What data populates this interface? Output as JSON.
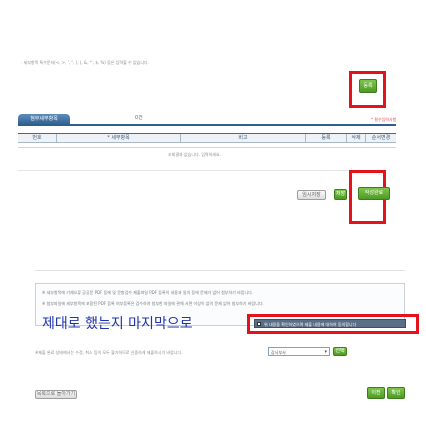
{
  "top_note": "· 세부항목 특수문자(<, >, ', \", (, ), &, ^, $, %) 등은 입력할 수 없습니다.",
  "save_button_label": "등록",
  "tab_label": "첨부세부항목",
  "count_label": "0건",
  "required_note": "* 필수입력사항",
  "table_headers": [
    "번호",
    "* 세부항목",
    "비고",
    "등록",
    "삭제",
    "순서변경"
  ],
  "empty_message": "조회결과 없습니다. 입력하세요.",
  "temp_save_label": "임시저장",
  "green_btn_label": "저장",
  "confirm_label": "작성완료",
  "notice_lines": [
    "※ 세부항목에 기재오류 공공문 PDF 등에 및 문항검수 제출파일 PDF 등록이 내용과 일치 등에 문제가 없어 첨부하기 바랍니다.",
    "※ 첨부파일에 세부항목에 포함된 PDF 등록 여부등록은 검수하여 첨부한 파일에 관해 서면 이상이 없이 문제 없어 첨부하기 바랍니다."
  ],
  "handwritten_note": "제대로 했는지 마지막으로",
  "checkbox_text": "위 내용을 확인하였으며 제출 내용에 대하여 동의합니다",
  "bottom_note": "※제출 완료 상태에서는 수정, 취소 등이 모두 불가하므로 신중하게 제출하시기 바랍니다.",
  "select_value": "감사부서",
  "select_button_label": "선택",
  "list_button_label": "목록으로 돌아가기",
  "bottom_btn_1": "이전",
  "bottom_btn_2": "확인",
  "colors": {
    "accent_red": "#e3121b",
    "button_green": "#5ea82c",
    "tab_blue": "#3a6c9a",
    "handwritten_blue": "#2233aa"
  },
  "icons": [
    "checkbox-icon",
    "chevron-down-icon"
  ]
}
